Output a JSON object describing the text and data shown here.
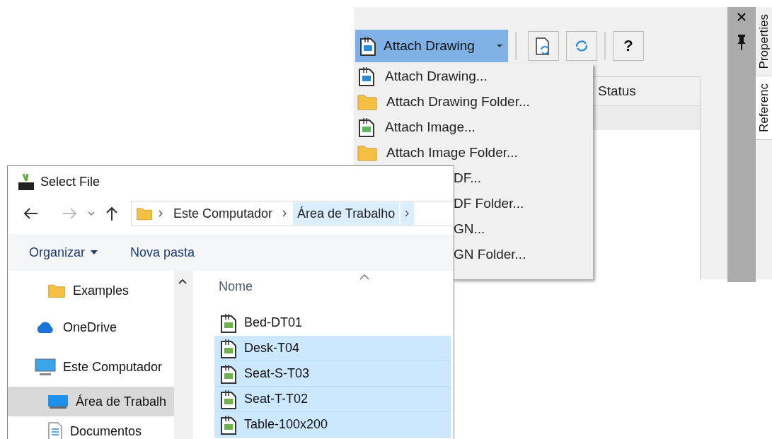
{
  "references_panel": {
    "toolbar": [
      {
        "kind": "split",
        "label": "Attach Drawing",
        "active": true
      },
      {
        "kind": "icon-attach-reload"
      },
      {
        "kind": "icon-reload"
      },
      {
        "kind": "text",
        "label": "?"
      }
    ],
    "menu": [
      {
        "label": "Attach Drawing...",
        "kind": "drawing",
        "covered": false
      },
      {
        "label": "Attach Drawing Folder...",
        "kind": "dwg-folder",
        "covered": false
      },
      {
        "label": "Attach Image...",
        "kind": "image",
        "covered": false
      },
      {
        "label": "Attach Image Folder...",
        "kind": "image-folder",
        "covered": false
      },
      {
        "label": "DF...",
        "covered": true
      },
      {
        "label": "DF Folder...",
        "covered": true
      },
      {
        "label": "GN...",
        "covered": true
      },
      {
        "label": "GN Folder...",
        "covered": true
      }
    ],
    "table": {
      "columns": [
        "Status"
      ]
    },
    "side_tabs": [
      {
        "label": "Properties",
        "selected": false
      },
      {
        "label": "Referenc",
        "selected": true
      }
    ]
  },
  "dialog": {
    "title": "Select File",
    "address": [
      {
        "label": "Este Computador",
        "selected": false
      },
      {
        "label": "Área de Trabalho",
        "selected": true
      }
    ],
    "commands": [
      {
        "label": "Organizar",
        "dropdown": true
      },
      {
        "label": "Nova pasta",
        "dropdown": false
      }
    ],
    "nav": [
      {
        "label": "Examples",
        "kind": "folder",
        "selected": false
      },
      {
        "label": "OneDrive",
        "kind": "cloud",
        "selected": false
      },
      {
        "label": "Este Computador",
        "kind": "computer",
        "selected": false,
        "children": [
          {
            "label": "Área de Trabalh",
            "kind": "desktop",
            "selected": true
          },
          {
            "label": "Documentos",
            "kind": "document",
            "selected": false
          }
        ]
      }
    ],
    "files": {
      "columns": [
        "Nome"
      ],
      "rows": [
        {
          "name": "Bed-DT01",
          "selected": false
        },
        {
          "name": "Desk-T04",
          "selected": true
        },
        {
          "name": "Seat-S-T03",
          "selected": true
        },
        {
          "name": "Seat-T-T02",
          "selected": true
        },
        {
          "name": "Table-100x200",
          "selected": true
        }
      ]
    }
  }
}
